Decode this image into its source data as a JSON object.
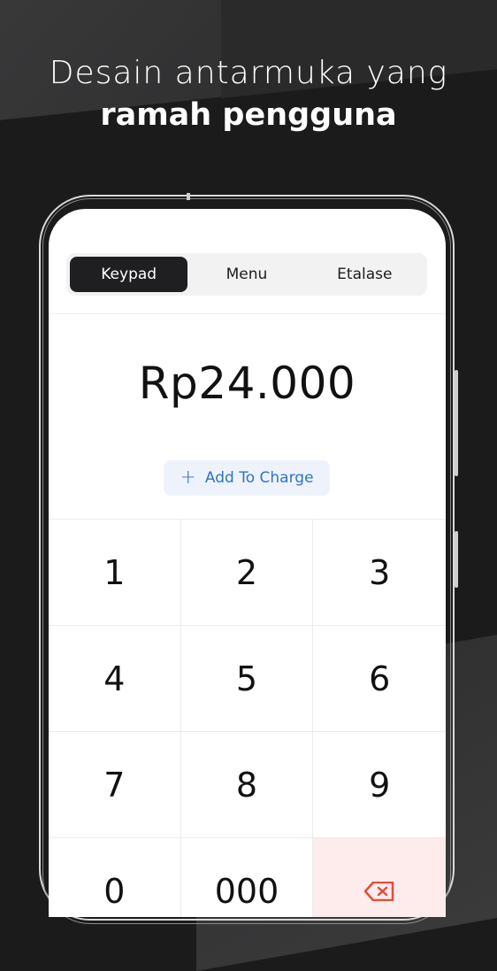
{
  "headline": {
    "line1": "Desain antarmuka yang",
    "line2": "ramah pengguna"
  },
  "tabs": [
    {
      "label": "Keypad",
      "active": true
    },
    {
      "label": "Menu",
      "active": false
    },
    {
      "label": "Etalase",
      "active": false
    }
  ],
  "amount": "Rp24.000",
  "add_charge": {
    "label": "Add To Charge",
    "icon": "plus-icon"
  },
  "keys": [
    "1",
    "2",
    "3",
    "4",
    "5",
    "6",
    "7",
    "8",
    "9",
    "0",
    "000"
  ],
  "delete_key": {
    "icon": "backspace-icon"
  },
  "colors": {
    "accent": "#2f73c9",
    "delete_bg": "#fdeceb",
    "tab_active": "#1f1f21"
  }
}
